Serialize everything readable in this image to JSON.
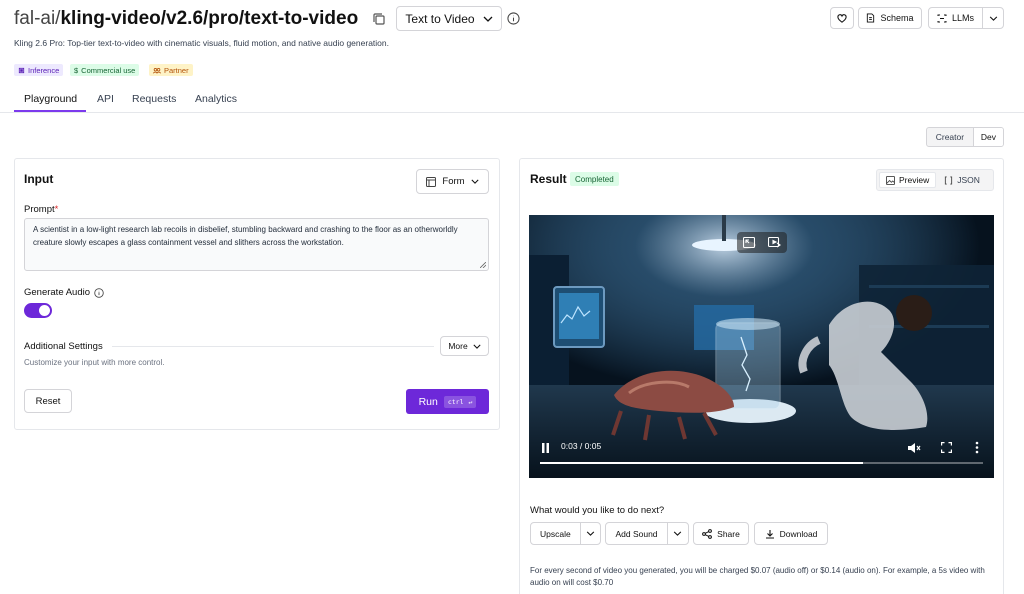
{
  "header": {
    "owner": "fal-ai/",
    "slug": "kling-video/v2.6/pro/text-to-video",
    "mode_selector": "Text to Video",
    "schema_label": "Schema",
    "llms_label": "LLMs",
    "subtitle": "Kling 2.6 Pro: Top-tier text-to-video with cinematic visuals, fluid motion, and native audio generation.",
    "badges": [
      {
        "label": "Inference",
        "icon": "chip-icon"
      },
      {
        "label": "Commercial use",
        "icon": "dollar-icon"
      },
      {
        "label": "Partner",
        "icon": "partner-icon"
      }
    ]
  },
  "tabs": [
    {
      "label": "Playground",
      "active": true
    },
    {
      "label": "API",
      "active": false
    },
    {
      "label": "Requests",
      "active": false
    },
    {
      "label": "Analytics",
      "active": false
    }
  ],
  "view_mode": {
    "creator": "Creator",
    "dev": "Dev",
    "selected": "Dev"
  },
  "input": {
    "title": "Input",
    "form_label": "Form",
    "prompt_label": "Prompt",
    "prompt_required_mark": "*",
    "prompt_value": "A scientist in a low-light research lab recoils in disbelief, stumbling backward and crashing to the floor as an otherworldly creature slowly escapes a glass containment vessel and slithers across the workstation.",
    "generate_audio_label": "Generate Audio",
    "generate_audio_on": true,
    "additional_settings_label": "Additional Settings",
    "additional_settings_hint": "Customize your input with more control.",
    "more_label": "More",
    "reset_label": "Reset",
    "run_label": "Run",
    "run_shortcut": [
      "ctrl",
      "↵"
    ]
  },
  "result": {
    "title": "Result",
    "status": "Completed",
    "preview_label": "Preview",
    "json_label": "JSON",
    "video": {
      "current_time": "0:03",
      "duration": "0:05",
      "time_display": "0:03 / 0:05",
      "progress": 0.73
    },
    "next_title": "What would you like to do next?",
    "actions": {
      "upscale": "Upscale",
      "add_sound": "Add Sound",
      "share": "Share",
      "download": "Download"
    },
    "pricing_note": "For every second of video you generated, you will be charged $0.07 (audio off) or $0.14 (audio on). For example, a 5s video with audio on will cost $0.70"
  },
  "colors": {
    "accent": "#6d28d9",
    "success_bg": "#dcfce7",
    "success_text": "#166534"
  }
}
